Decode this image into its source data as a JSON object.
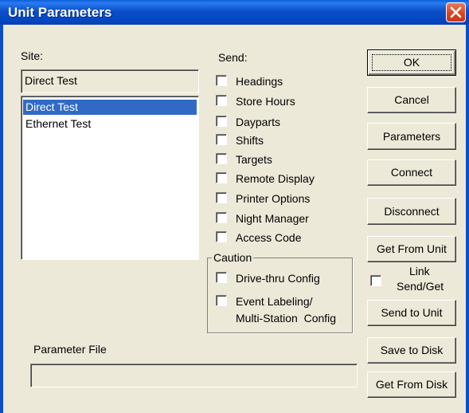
{
  "window": {
    "title": "Unit Parameters"
  },
  "site": {
    "label": "Site:",
    "selected_value": "Direct Test",
    "list": [
      "Direct Test",
      "Ethernet Test"
    ]
  },
  "send": {
    "label": "Send:",
    "options": [
      "Headings",
      "Store Hours",
      "Dayparts",
      "Shifts",
      "Targets",
      "Remote Display",
      "Printer Options",
      "Night Manager",
      "Access Code"
    ]
  },
  "caution": {
    "label": "Caution",
    "drive_thru": "Drive-thru Config",
    "event_line1": "Event Labeling/",
    "event_line2": "Multi-Station  Config"
  },
  "buttons": {
    "ok": "OK",
    "cancel": "Cancel",
    "parameters": "Parameters",
    "connect": "Connect",
    "disconnect": "Disconnect",
    "get_from_unit": "Get From Unit",
    "send_to_unit": "Send to Unit",
    "save_to_disk": "Save to Disk",
    "get_from_disk": "Get From Disk"
  },
  "link": {
    "line1": "Link",
    "line2": "Send/Get"
  },
  "parameter_file": {
    "label": "Parameter File",
    "value": ""
  }
}
